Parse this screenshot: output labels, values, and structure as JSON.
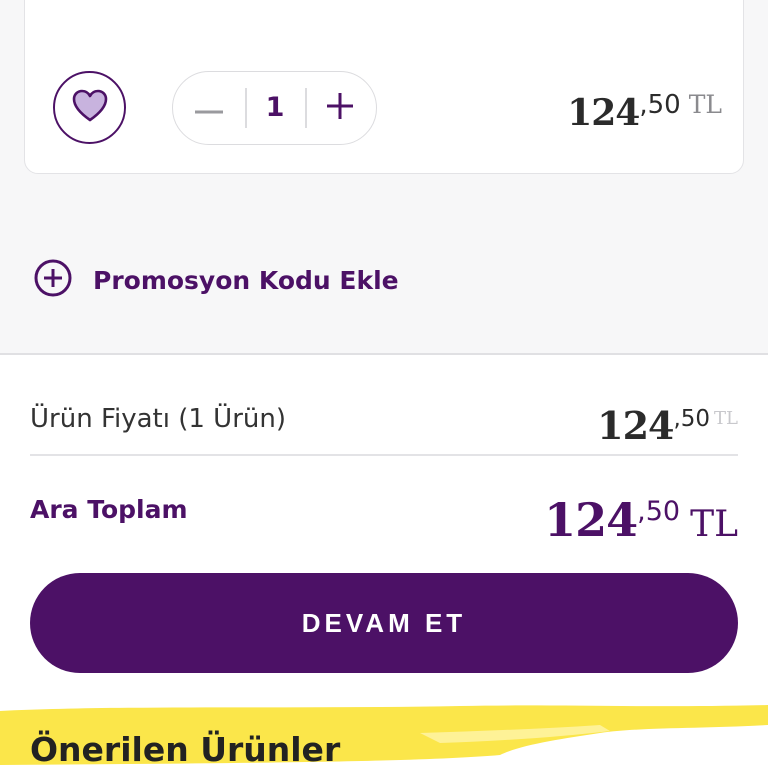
{
  "cart_item": {
    "quantity": "1",
    "price": {
      "integer": "124",
      "cents": ",50",
      "currency": "TL"
    }
  },
  "promo": {
    "label": "Promosyon Kodu Ekle"
  },
  "summary": {
    "product_price_label": "Ürün Fiyatı (1 Ürün)",
    "product_price": {
      "integer": "124",
      "cents": ",50",
      "currency": "TL"
    },
    "subtotal_label": "Ara Toplam",
    "subtotal": {
      "integer": "124",
      "cents": ",50",
      "currency": "TL"
    }
  },
  "checkout": {
    "label": "DEVAM ET"
  },
  "recommended": {
    "title": "Önerilen Ürünler"
  },
  "colors": {
    "brand": "#4c1166",
    "heart_fill": "#c8b3de",
    "highlight": "#fbe64a"
  },
  "icons": [
    "heart-icon",
    "minus-icon",
    "plus-icon",
    "add-circle-icon"
  ]
}
